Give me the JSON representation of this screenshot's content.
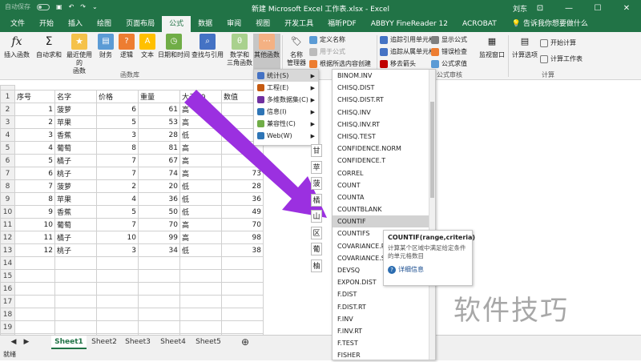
{
  "window": {
    "autosave": "自动保存",
    "title": "新建 Microsoft Excel 工作表.xlsx - Excel",
    "user": "刘东"
  },
  "ribbon_tabs": [
    "文件",
    "开始",
    "插入",
    "绘图",
    "页面布局",
    "公式",
    "数据",
    "审阅",
    "视图",
    "开发工具",
    "福昕PDF",
    "ABBYY FineReader 12",
    "ACROBAT"
  ],
  "tell_me": "告诉我你想要做什么",
  "ribbon": {
    "insert_function": "插入函数",
    "autosum": "自动求和",
    "recent": "最近使用的\n函数",
    "financial": "财务",
    "logical": "逻辑",
    "text": "文本",
    "datetime": "日期和时间",
    "lookup": "查找与引用",
    "math": "数学和\n三角函数",
    "more": "其他函数",
    "name_manager": "名称\n管理器",
    "define_name": "定义名称",
    "use_in_formula": "用于公式",
    "create_from_sel": "根据所选内容创建",
    "trace_prec": "追踪引用单元格",
    "trace_dep": "追踪从属单元格",
    "remove_arrows": "移去箭头",
    "show_formulas": "显示公式",
    "error_check": "错误检查",
    "eval_formula": "公式求值",
    "watch_window": "监视窗口",
    "calc_options": "计算选项",
    "calc_now": "开始计算",
    "calc_sheet": "计算工作表",
    "group_library": "函数库",
    "group_audit": "公式审核",
    "group_calc": "计算"
  },
  "grid": {
    "row_numbers": [
      "1",
      "2",
      "3",
      "4",
      "5",
      "6",
      "7",
      "8",
      "9",
      "10",
      "11",
      "12",
      "13",
      "14",
      "15",
      "16",
      "17",
      "18",
      "19",
      "20"
    ],
    "headers": [
      "序号",
      "名字",
      "价格",
      "重量",
      "大于50",
      "数值"
    ],
    "rows": [
      [
        "1",
        "菠萝",
        "6",
        "61",
        "高",
        ""
      ],
      [
        "2",
        "苹果",
        "5",
        "53",
        "高",
        ""
      ],
      [
        "3",
        "香蕉",
        "3",
        "28",
        "低",
        ""
      ],
      [
        "4",
        "葡萄",
        "8",
        "81",
        "高",
        ""
      ],
      [
        "5",
        "橘子",
        "7",
        "67",
        "高",
        "67"
      ],
      [
        "6",
        "桃子",
        "7",
        "74",
        "高",
        "73"
      ],
      [
        "7",
        "菠萝",
        "2",
        "20",
        "低",
        "28"
      ],
      [
        "8",
        "苹果",
        "4",
        "36",
        "低",
        "36"
      ],
      [
        "9",
        "香蕉",
        "5",
        "50",
        "低",
        "49"
      ],
      [
        "10",
        "葡萄",
        "7",
        "70",
        "高",
        "70"
      ],
      [
        "11",
        "橘子",
        "10",
        "99",
        "高",
        "98"
      ],
      [
        "12",
        "桃子",
        "3",
        "34",
        "低",
        "38"
      ]
    ],
    "side_col": [
      "甘",
      "苹",
      "菠",
      "橘",
      "山",
      "区",
      "葡",
      "柚"
    ]
  },
  "submenu": {
    "items": [
      "统计(S)",
      "工程(E)",
      "多维数据集(C)",
      "信息(I)",
      "兼容性(C)",
      "Web(W)"
    ],
    "colors": [
      "#4472c4",
      "#c55a11",
      "#7030a0",
      "#2e75b6",
      "#70ad47",
      "#2e75b6"
    ]
  },
  "function_list": [
    "BINOM.INV",
    "CHISQ.DIST",
    "CHISQ.DIST.RT",
    "CHISQ.INV",
    "CHISQ.INV.RT",
    "CHISQ.TEST",
    "CONFIDENCE.NORM",
    "CONFIDENCE.T",
    "CORREL",
    "COUNT",
    "COUNTA",
    "COUNTBLANK",
    "COUNTIF",
    "COUNTIFS",
    "COVARIANCE.P",
    "COVARIANCE.S",
    "DEVSQ",
    "EXPON.DIST",
    "F.DIST",
    "F.DIST.RT",
    "F.INV",
    "F.INV.RT",
    "F.TEST",
    "FISHER"
  ],
  "selected_function": "COUNTIF",
  "tooltip": {
    "signature": "COUNTIF(range,criteria)",
    "description": "计算某个区域中满足给定条件的单元格数目",
    "more_info": "详细信息"
  },
  "sheets": [
    "Sheet1",
    "Sheet2",
    "Sheet3",
    "Sheet4",
    "Sheet5"
  ],
  "active_sheet": "Sheet1",
  "status": "就绪",
  "watermark": "软件技巧",
  "colors": {
    "brand": "#217346",
    "arrow": "#9b30e0"
  }
}
